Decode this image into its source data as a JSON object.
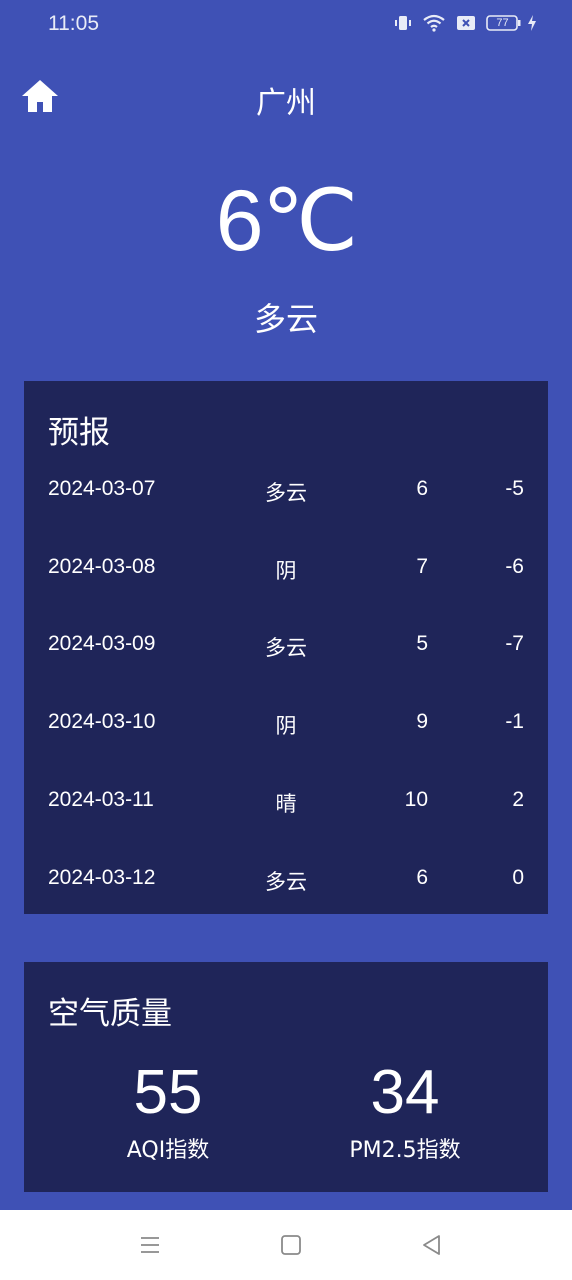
{
  "status_bar": {
    "time": "11:05",
    "battery": "77"
  },
  "header": {
    "city": "广州"
  },
  "current": {
    "temperature": "6℃",
    "condition": "多云"
  },
  "forecast": {
    "title": "预报",
    "rows": [
      {
        "date": "2024-03-07",
        "condition": "多云",
        "high": "6",
        "low": "-5"
      },
      {
        "date": "2024-03-08",
        "condition": "阴",
        "high": "7",
        "low": "-6"
      },
      {
        "date": "2024-03-09",
        "condition": "多云",
        "high": "5",
        "low": "-7"
      },
      {
        "date": "2024-03-10",
        "condition": "阴",
        "high": "9",
        "low": "-1"
      },
      {
        "date": "2024-03-11",
        "condition": "晴",
        "high": "10",
        "low": "2"
      },
      {
        "date": "2024-03-12",
        "condition": "多云",
        "high": "6",
        "low": "0"
      }
    ]
  },
  "air_quality": {
    "title": "空气质量",
    "aqi_value": "55",
    "aqi_label": "AQI指数",
    "pm25_value": "34",
    "pm25_label": "PM2.5指数"
  },
  "icons": {
    "home": "home-icon",
    "vibrate": "vibrate-icon",
    "wifi": "wifi-icon",
    "sim": "sim-icon",
    "battery": "battery-icon",
    "charging": "charging-icon",
    "menu": "menu-icon",
    "home_square": "square-icon",
    "back": "back-icon"
  },
  "colors": {
    "background": "#3f51b5",
    "card": "#1f2559",
    "text": "#ffffff"
  }
}
